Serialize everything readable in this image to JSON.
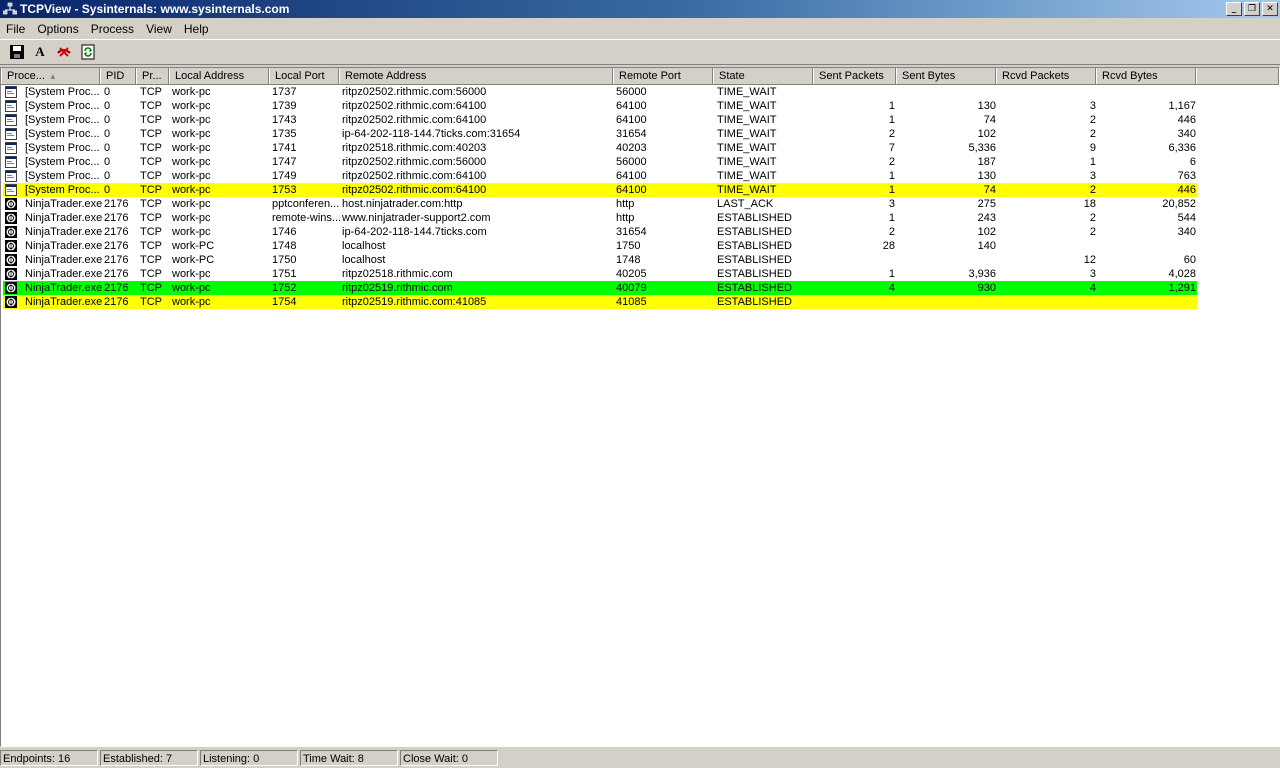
{
  "window": {
    "title": "TCPView - Sysinternals: www.sysinternals.com",
    "minimize_label": "_",
    "restore_label": "❐",
    "close_label": "✕"
  },
  "menu": [
    "File",
    "Options",
    "Process",
    "View",
    "Help"
  ],
  "toolbar": {
    "save_icon": "floppy-disk",
    "font_label": "A",
    "close_connection_icon": "red-x-cable",
    "refresh_icon": "green-arrows"
  },
  "columns": [
    "Proce...",
    "PID",
    "Pr...",
    "Local Address",
    "Local Port",
    "Remote Address",
    "Remote Port",
    "State",
    "Sent Packets",
    "Sent Bytes",
    "Rcvd Packets",
    "Rcvd Bytes"
  ],
  "sort_indicator": "▲",
  "rows": [
    {
      "process": "[System Proc...",
      "pid": "0",
      "protocol": "TCP",
      "local_address": "work-pc",
      "local_port": "1737",
      "remote_address": "ritpz02502.rithmic.com:56000",
      "remote_port": "56000",
      "state": "TIME_WAIT",
      "sent_packets": "",
      "sent_bytes": "",
      "rcvd_packets": "",
      "rcvd_bytes": "",
      "highlight": "none",
      "icon": "system-window"
    },
    {
      "process": "[System Proc...",
      "pid": "0",
      "protocol": "TCP",
      "local_address": "work-pc",
      "local_port": "1739",
      "remote_address": "ritpz02502.rithmic.com:64100",
      "remote_port": "64100",
      "state": "TIME_WAIT",
      "sent_packets": "1",
      "sent_bytes": "130",
      "rcvd_packets": "3",
      "rcvd_bytes": "1,167",
      "highlight": "none",
      "icon": "system-window"
    },
    {
      "process": "[System Proc...",
      "pid": "0",
      "protocol": "TCP",
      "local_address": "work-pc",
      "local_port": "1743",
      "remote_address": "ritpz02502.rithmic.com:64100",
      "remote_port": "64100",
      "state": "TIME_WAIT",
      "sent_packets": "1",
      "sent_bytes": "74",
      "rcvd_packets": "2",
      "rcvd_bytes": "446",
      "highlight": "none",
      "icon": "system-window"
    },
    {
      "process": "[System Proc...",
      "pid": "0",
      "protocol": "TCP",
      "local_address": "work-pc",
      "local_port": "1735",
      "remote_address": "ip-64-202-118-144.7ticks.com:31654",
      "remote_port": "31654",
      "state": "TIME_WAIT",
      "sent_packets": "2",
      "sent_bytes": "102",
      "rcvd_packets": "2",
      "rcvd_bytes": "340",
      "highlight": "none",
      "icon": "system-window"
    },
    {
      "process": "[System Proc...",
      "pid": "0",
      "protocol": "TCP",
      "local_address": "work-pc",
      "local_port": "1741",
      "remote_address": "ritpz02518.rithmic.com:40203",
      "remote_port": "40203",
      "state": "TIME_WAIT",
      "sent_packets": "7",
      "sent_bytes": "5,336",
      "rcvd_packets": "9",
      "rcvd_bytes": "6,336",
      "highlight": "none",
      "icon": "system-window"
    },
    {
      "process": "[System Proc...",
      "pid": "0",
      "protocol": "TCP",
      "local_address": "work-pc",
      "local_port": "1747",
      "remote_address": "ritpz02502.rithmic.com:56000",
      "remote_port": "56000",
      "state": "TIME_WAIT",
      "sent_packets": "2",
      "sent_bytes": "187",
      "rcvd_packets": "1",
      "rcvd_bytes": "6",
      "highlight": "none",
      "icon": "system-window"
    },
    {
      "process": "[System Proc...",
      "pid": "0",
      "protocol": "TCP",
      "local_address": "work-pc",
      "local_port": "1749",
      "remote_address": "ritpz02502.rithmic.com:64100",
      "remote_port": "64100",
      "state": "TIME_WAIT",
      "sent_packets": "1",
      "sent_bytes": "130",
      "rcvd_packets": "3",
      "rcvd_bytes": "763",
      "highlight": "none",
      "icon": "system-window"
    },
    {
      "process": "[System Proc...",
      "pid": "0",
      "protocol": "TCP",
      "local_address": "work-pc",
      "local_port": "1753",
      "remote_address": "ritpz02502.rithmic.com:64100",
      "remote_port": "64100",
      "state": "TIME_WAIT",
      "sent_packets": "1",
      "sent_bytes": "74",
      "rcvd_packets": "2",
      "rcvd_bytes": "446",
      "highlight": "yellow",
      "icon": "system-window"
    },
    {
      "process": "NinjaTrader.exe",
      "pid": "2176",
      "protocol": "TCP",
      "local_address": "work-pc",
      "local_port": "pptconferen...",
      "remote_address": "host.ninjatrader.com:http",
      "remote_port": "http",
      "state": "LAST_ACK",
      "sent_packets": "3",
      "sent_bytes": "275",
      "rcvd_packets": "18",
      "rcvd_bytes": "20,852",
      "highlight": "none",
      "icon": "ninjatrader"
    },
    {
      "process": "NinjaTrader.exe",
      "pid": "2176",
      "protocol": "TCP",
      "local_address": "work-pc",
      "local_port": "remote-wins...",
      "remote_address": "www.ninjatrader-support2.com",
      "remote_port": "http",
      "state": "ESTABLISHED",
      "sent_packets": "1",
      "sent_bytes": "243",
      "rcvd_packets": "2",
      "rcvd_bytes": "544",
      "highlight": "none",
      "icon": "ninjatrader"
    },
    {
      "process": "NinjaTrader.exe",
      "pid": "2176",
      "protocol": "TCP",
      "local_address": "work-pc",
      "local_port": "1746",
      "remote_address": "ip-64-202-118-144.7ticks.com",
      "remote_port": "31654",
      "state": "ESTABLISHED",
      "sent_packets": "2",
      "sent_bytes": "102",
      "rcvd_packets": "2",
      "rcvd_bytes": "340",
      "highlight": "none",
      "icon": "ninjatrader"
    },
    {
      "process": "NinjaTrader.exe",
      "pid": "2176",
      "protocol": "TCP",
      "local_address": "work-PC",
      "local_port": "1748",
      "remote_address": "localhost",
      "remote_port": "1750",
      "state": "ESTABLISHED",
      "sent_packets": "28",
      "sent_bytes": "140",
      "rcvd_packets": "",
      "rcvd_bytes": "",
      "highlight": "none",
      "icon": "ninjatrader"
    },
    {
      "process": "NinjaTrader.exe",
      "pid": "2176",
      "protocol": "TCP",
      "local_address": "work-PC",
      "local_port": "1750",
      "remote_address": "localhost",
      "remote_port": "1748",
      "state": "ESTABLISHED",
      "sent_packets": "",
      "sent_bytes": "",
      "rcvd_packets": "12",
      "rcvd_bytes": "60",
      "highlight": "none",
      "icon": "ninjatrader"
    },
    {
      "process": "NinjaTrader.exe",
      "pid": "2176",
      "protocol": "TCP",
      "local_address": "work-pc",
      "local_port": "1751",
      "remote_address": "ritpz02518.rithmic.com",
      "remote_port": "40205",
      "state": "ESTABLISHED",
      "sent_packets": "1",
      "sent_bytes": "3,936",
      "rcvd_packets": "3",
      "rcvd_bytes": "4,028",
      "highlight": "none",
      "icon": "ninjatrader"
    },
    {
      "process": "NinjaTrader.exe",
      "pid": "2176",
      "protocol": "TCP",
      "local_address": "work-pc",
      "local_port": "1752",
      "remote_address": "ritpz02519.rithmic.com",
      "remote_port": "40079",
      "state": "ESTABLISHED",
      "sent_packets": "4",
      "sent_bytes": "930",
      "rcvd_packets": "4",
      "rcvd_bytes": "1,291",
      "highlight": "green",
      "icon": "ninjatrader"
    },
    {
      "process": "NinjaTrader.exe",
      "pid": "2176",
      "protocol": "TCP",
      "local_address": "work-pc",
      "local_port": "1754",
      "remote_address": "ritpz02519.rithmic.com:41085",
      "remote_port": "41085",
      "state": "ESTABLISHED",
      "sent_packets": "",
      "sent_bytes": "",
      "rcvd_packets": "",
      "rcvd_bytes": "",
      "highlight": "yellow",
      "icon": "ninjatrader"
    }
  ],
  "status": {
    "endpoints": "Endpoints: 16",
    "established": "Established: 7",
    "listening": "Listening: 0",
    "time_wait": "Time Wait: 8",
    "close_wait": "Close Wait: 0"
  },
  "colors": {
    "new_connection": "#00ff00",
    "closing_connection": "#ffff00",
    "titlebar": "#0a246a"
  }
}
